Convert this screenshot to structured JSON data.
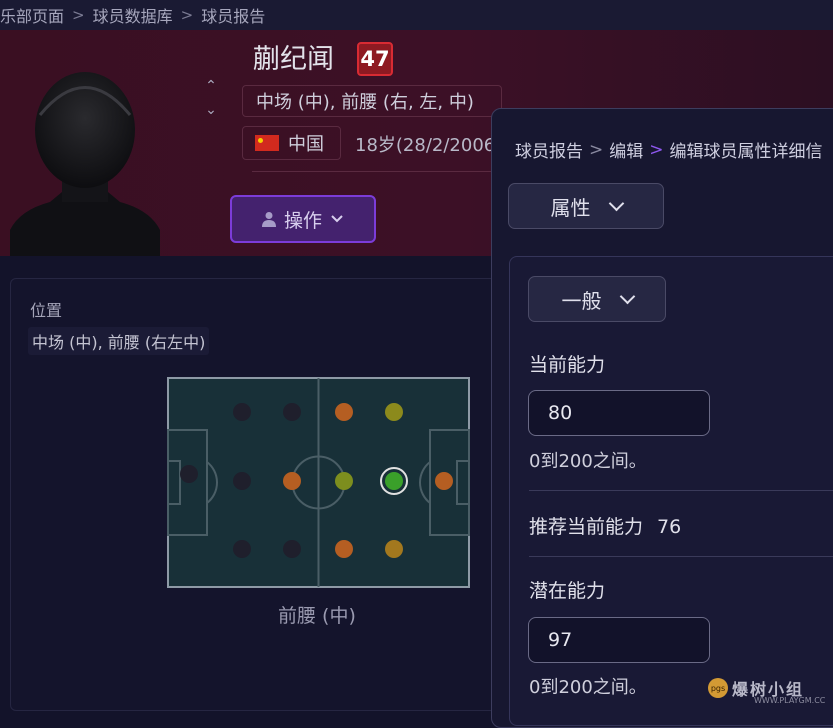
{
  "breadcrumb": {
    "items": [
      "俱乐部页面",
      "球员数据库",
      "球员报告"
    ]
  },
  "player": {
    "name": "蒯纪闻",
    "current_ability_badge": "47",
    "positions": "中场 (中), 前腰 (右, 左, 中)",
    "nation": "中国",
    "age": "18岁(28/2/2006"
  },
  "actions_button": {
    "label": "操作"
  },
  "position_panel": {
    "heading": "位置",
    "detail": "中场 (中), 前腰 (右左中)",
    "selected_position": "前腰 (中)"
  },
  "dialog": {
    "breadcrumb": [
      "球员报告",
      "编辑",
      "编辑球员属性详细信"
    ],
    "category_select": "属性",
    "subcategory_select": "一般",
    "current_ability": {
      "label": "当前能力",
      "value": "80",
      "hint": "0到200之间。"
    },
    "recommended": {
      "label": "推荐当前能力",
      "value": "76"
    },
    "potential_ability": {
      "label": "潜在能力",
      "value": "97",
      "hint": "0到200之间。"
    }
  },
  "watermark": {
    "text": "爆树小组",
    "sub": "WWW.PLAYGM.CC",
    "logo": "pgs"
  },
  "colors": {
    "accent_purple": "#7c3cd9",
    "badge_red": "#d82b33",
    "header_bg": "#3a0f22"
  }
}
